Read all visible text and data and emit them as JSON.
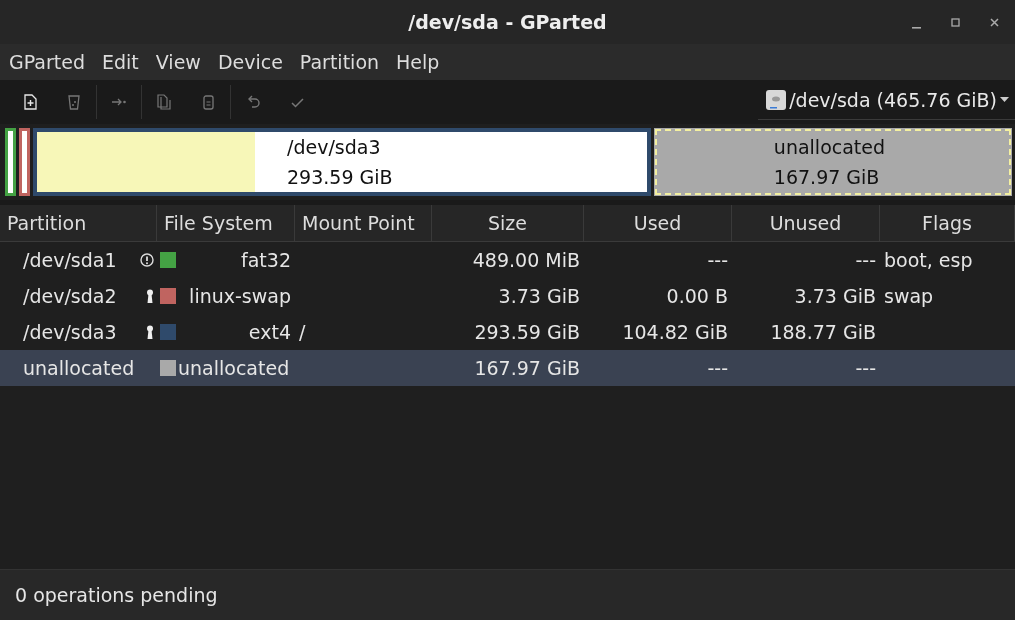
{
  "window": {
    "title": "/dev/sda - GParted"
  },
  "menu": [
    "GParted",
    "Edit",
    "View",
    "Device",
    "Partition",
    "Help"
  ],
  "toolbar": [
    {
      "kind": "new",
      "disabled": false
    },
    {
      "kind": "delete",
      "disabled": true
    },
    {
      "kind": "resize",
      "disabled": true
    },
    {
      "kind": "copy",
      "disabled": true
    },
    {
      "kind": "paste",
      "disabled": true
    },
    {
      "kind": "undo",
      "disabled": true
    },
    {
      "kind": "apply",
      "disabled": true
    }
  ],
  "device": {
    "label": "/dev/sda (465.76 GiB)"
  },
  "disk_map": [
    {
      "kind": "sliver",
      "color": "#44a244",
      "selected": false
    },
    {
      "kind": "sliver",
      "color": "#c06460",
      "selected": false
    },
    {
      "kind": "partition",
      "color": "#2f4a6b",
      "level": 0.357,
      "name": "/dev/sda3",
      "size": "293.59 GiB",
      "selected": false
    },
    {
      "kind": "unallocated",
      "color": "#a9a9a9",
      "name": "unallocated",
      "size": "167.97 GiB",
      "selected": true
    }
  ],
  "table": {
    "columns": [
      "Partition",
      "File System",
      "Mount Point",
      "Size",
      "Used",
      "Unused",
      "Flags"
    ],
    "rows": [
      {
        "partition": "/dev/sda1",
        "warning": true,
        "mounted": false,
        "color": "#44a244",
        "fs": "fat32",
        "mount": "",
        "size": "489.00 MiB",
        "used": "---",
        "unused": "---",
        "flags": "boot, esp",
        "selected": false
      },
      {
        "partition": "/dev/sda2",
        "warning": false,
        "mounted": true,
        "color": "#c06460",
        "fs": "linux-swap",
        "mount": "",
        "size": "3.73 GiB",
        "used": "0.00 B",
        "unused": "3.73 GiB",
        "flags": "swap",
        "selected": false
      },
      {
        "partition": "/dev/sda3",
        "warning": false,
        "mounted": true,
        "color": "#2f4a6b",
        "fs": "ext4",
        "mount": "/",
        "size": "293.59 GiB",
        "used": "104.82 GiB",
        "unused": "188.77 GiB",
        "flags": "",
        "selected": false
      },
      {
        "partition": "unallocated",
        "warning": false,
        "mounted": false,
        "color": "#a9a9a9",
        "fs": "unallocated",
        "mount": "",
        "size": "167.97 GiB",
        "used": "---",
        "unused": "---",
        "flags": "",
        "selected": true
      }
    ]
  },
  "status_bar": "0 operations pending"
}
